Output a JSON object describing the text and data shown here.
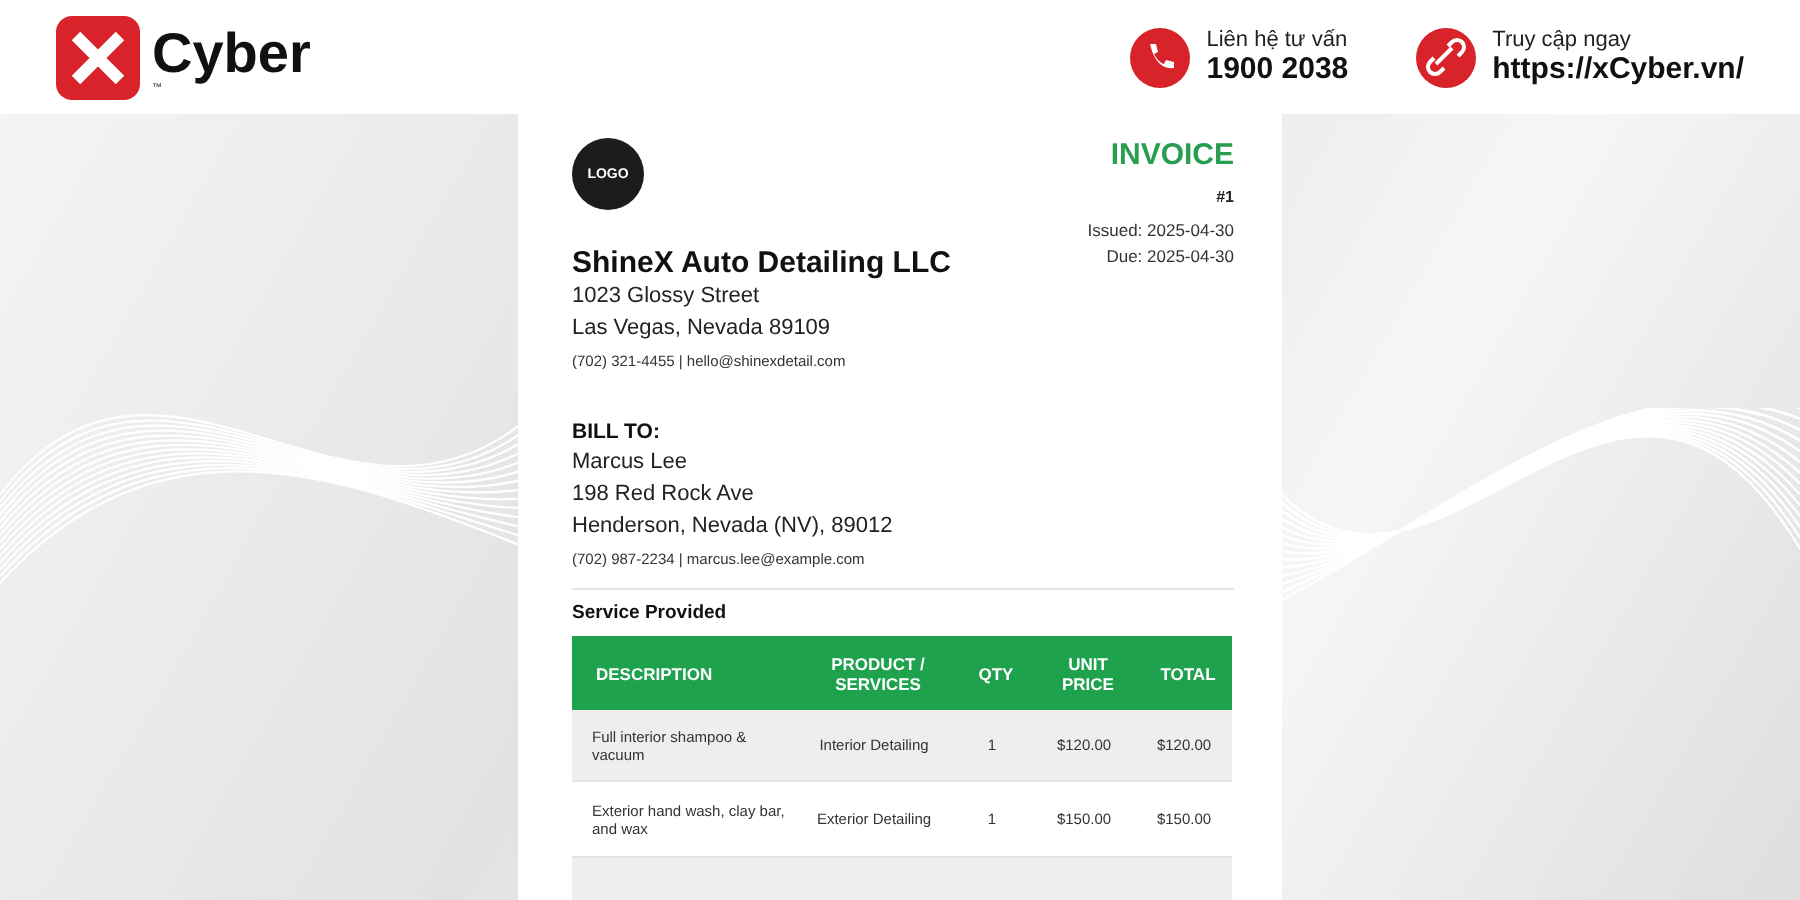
{
  "header": {
    "brand": "Cyber",
    "brand_mark": "™",
    "contacts": [
      {
        "kind": "phone",
        "label": "Liên hệ tư vấn",
        "value": "1900 2038"
      },
      {
        "kind": "link",
        "label": "Truy cập ngay",
        "value": "https://xCyber.vn/"
      }
    ]
  },
  "invoice": {
    "logo": "LOGO",
    "title": "INVOICE",
    "number": "#1",
    "dates": [
      "Issued: 2025-04-30",
      "Due: 2025-04-30"
    ],
    "company": {
      "name": "ShineX Auto Detailing LLC",
      "lines": [
        "1023 Glossy Street",
        "Las Vegas, Nevada 89109"
      ],
      "contact": "(702) 321-4455 | hello@shinexdetail.com"
    },
    "bill_to": {
      "heading": "BILL TO:",
      "lines": [
        "Marcus Lee",
        "198 Red Rock Ave",
        "Henderson, Nevada (NV), 89012"
      ],
      "contact": "(702) 987-2234 | marcus.lee@example.com"
    },
    "section_title": "Service Provided",
    "table": {
      "columns": [
        "DESCRIPTION",
        "PRODUCT / SERVICES",
        "QTY",
        "UNIT PRICE",
        "TOTAL"
      ],
      "rows": [
        [
          "Full interior shampoo & vacuum",
          "Interior Detailing",
          "1",
          "$120.00",
          "$120.00"
        ],
        [
          "Exterior hand wash, clay bar, and wax",
          "Exterior Detailing",
          "1",
          "$150.00",
          "$150.00"
        ],
        []
      ]
    }
  }
}
